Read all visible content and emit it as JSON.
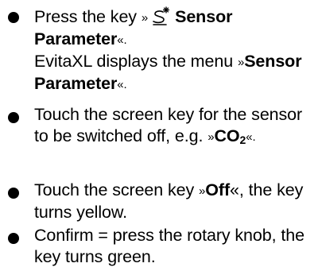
{
  "steps": [
    {
      "line1_prefix": "Press the key ",
      "line1_quote_open": "»",
      "icon": "sensor-icon",
      "line1_bold": "Sensor",
      "line2_bold": "Parameter",
      "line2_quote_close": "«.",
      "line3": "EvitaXL displays the menu ",
      "line3_quote_open": "»",
      "line3_bold": "Sensor",
      "line4_bold": "Parameter",
      "line4_quote_close": "«."
    },
    {
      "line1": "Touch the screen key for the sensor",
      "line2_prefix": "to be switched off, e.g. ",
      "line2_quote_open": "»",
      "line2_bold": "CO",
      "line2_sub": "2",
      "line2_quote_close": "«."
    },
    {
      "line1_prefix": "Touch the screen key ",
      "line1_quote_open": "»",
      "line1_bold": "Off",
      "line1_suffix": "«, the key",
      "line2": "turns yellow."
    },
    {
      "line1": "Confirm = press the rotary knob, the",
      "line2": "key turns green."
    }
  ]
}
